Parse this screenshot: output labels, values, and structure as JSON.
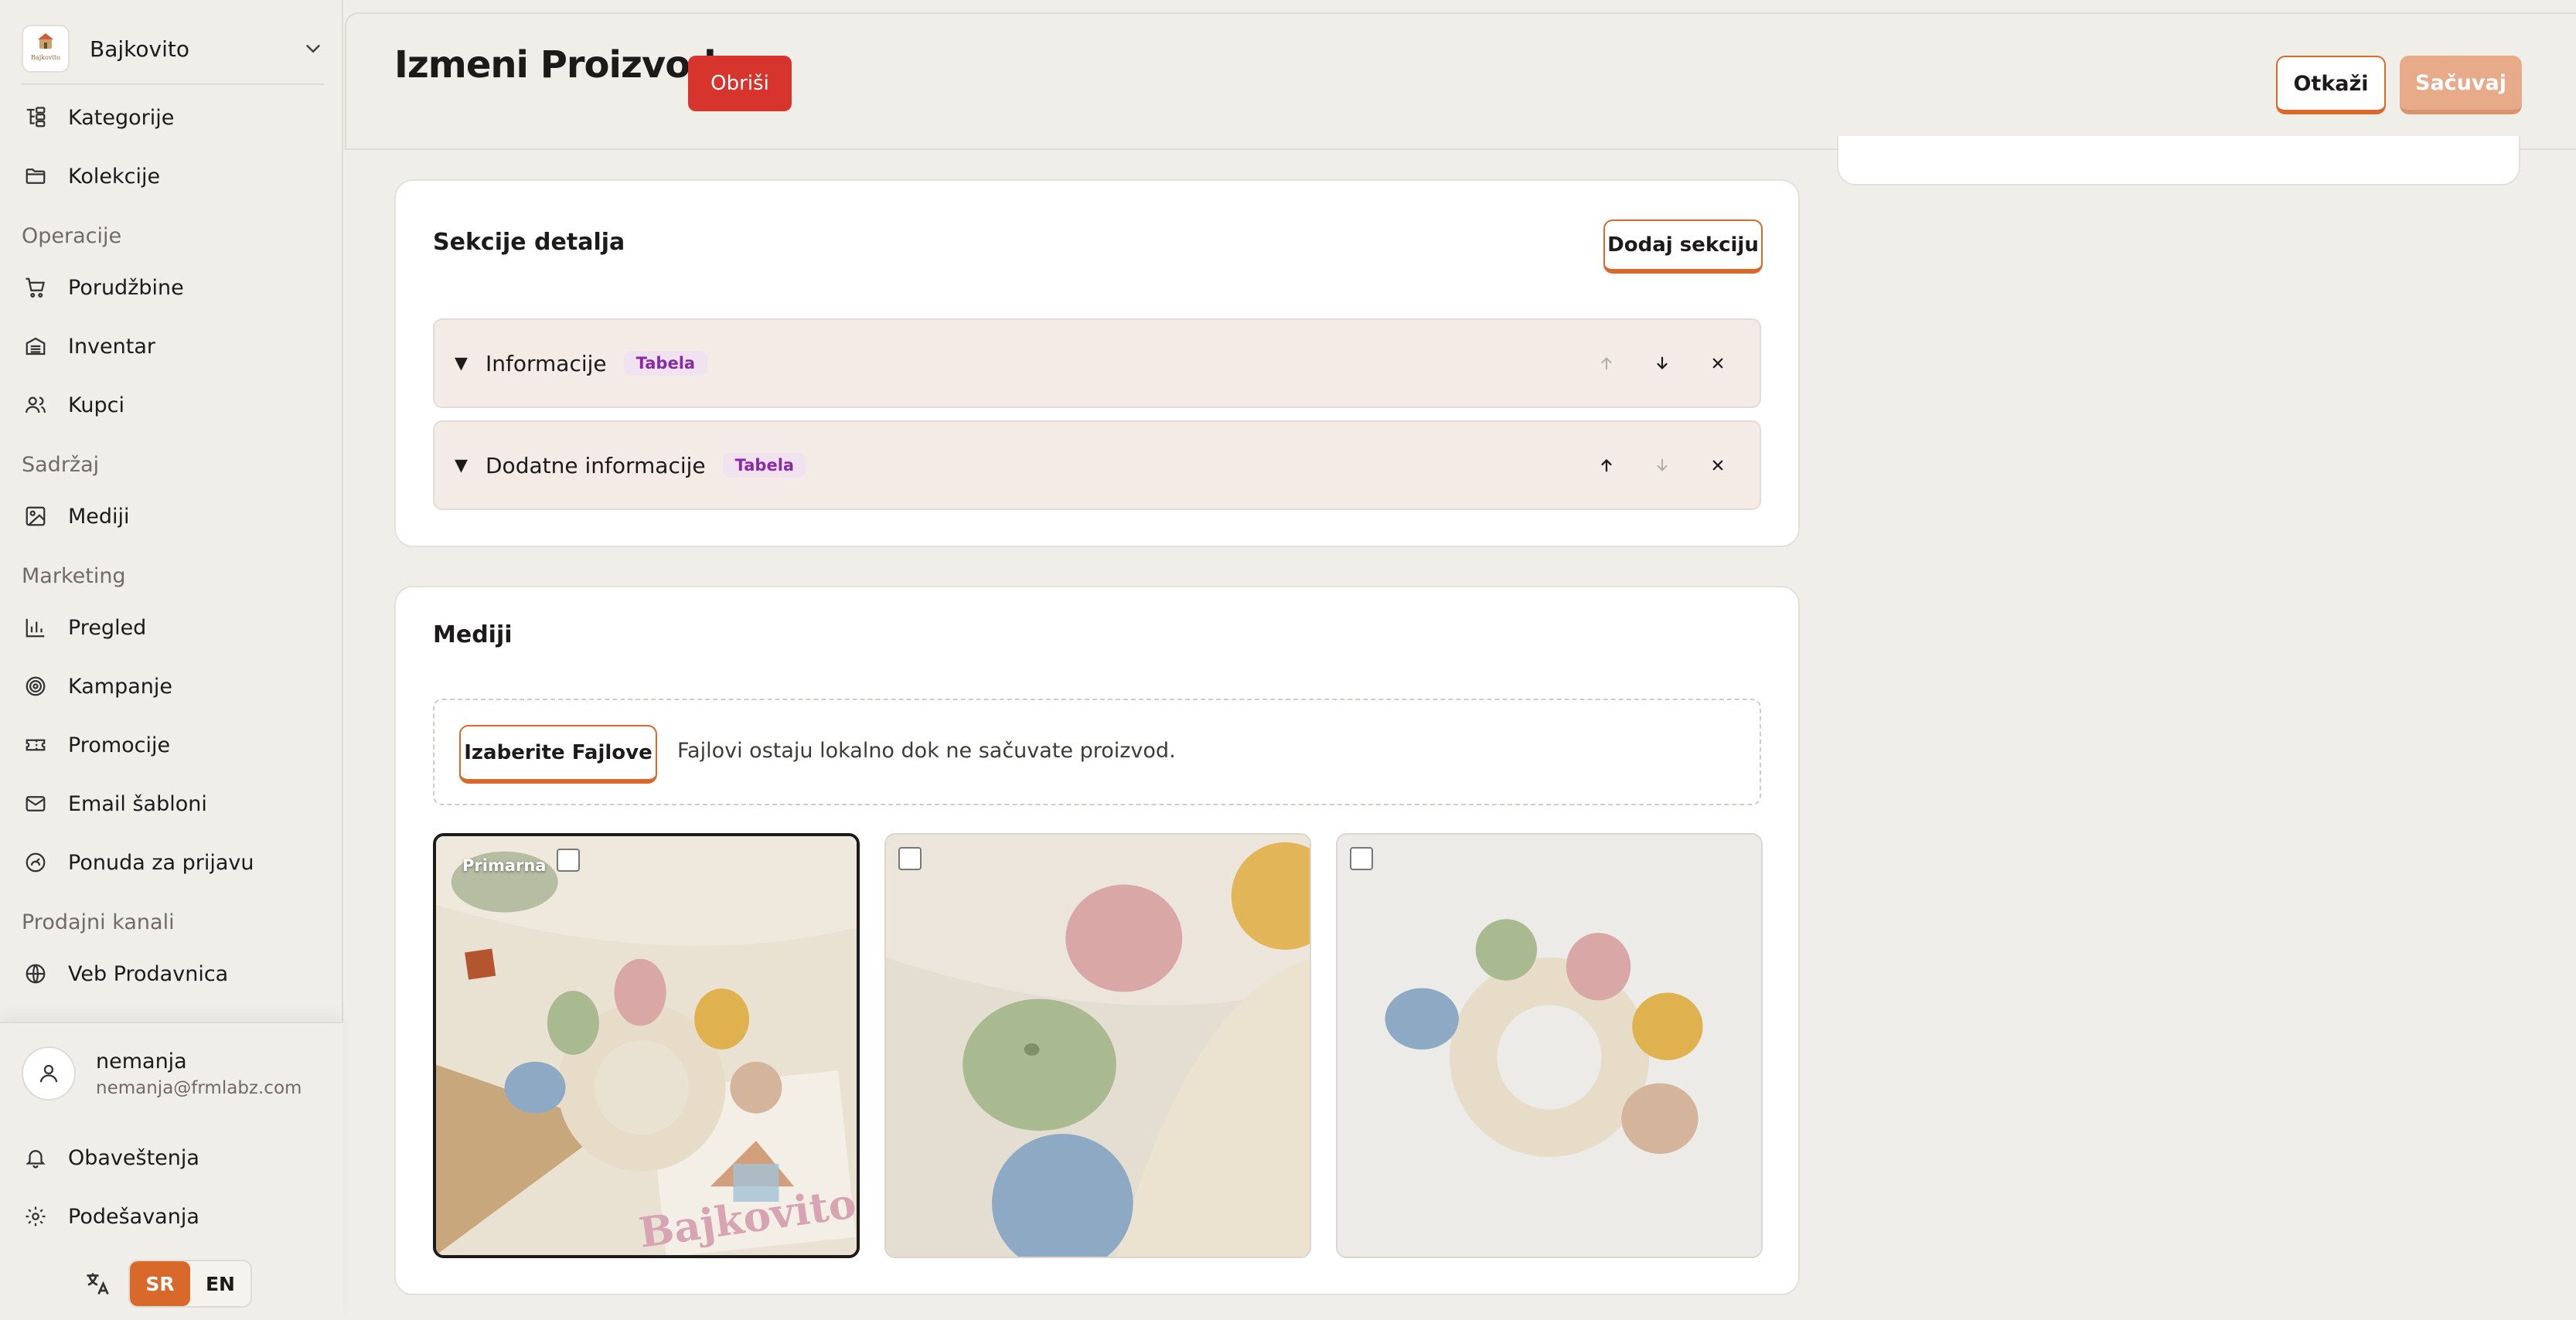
{
  "store": {
    "name": "Bajkovito",
    "logo_text": "Bajkovito"
  },
  "nav": {
    "items_top": [
      {
        "label": "Kategorije"
      },
      {
        "label": "Kolekcije"
      }
    ],
    "sections": {
      "operations": "Operacije",
      "content": "Sadržaj",
      "marketing": "Marketing",
      "channels": "Prodajni kanali"
    },
    "operations_items": [
      {
        "label": "Porudžbine"
      },
      {
        "label": "Inventar"
      },
      {
        "label": "Kupci"
      }
    ],
    "content_items": [
      {
        "label": "Mediji"
      }
    ],
    "marketing_items": [
      {
        "label": "Pregled"
      },
      {
        "label": "Kampanje"
      },
      {
        "label": "Promocije"
      },
      {
        "label": "Email šabloni"
      },
      {
        "label": "Ponuda za prijavu"
      }
    ],
    "channel_items": [
      {
        "label": "Veb Prodavnica"
      }
    ]
  },
  "user": {
    "name": "nemanja",
    "email": "nemanja@frmlabz.com"
  },
  "bottom_nav": {
    "notifications": "Obaveštenja",
    "settings": "Podešavanja"
  },
  "language": {
    "options": [
      "SR",
      "EN"
    ],
    "selected": "SR"
  },
  "header": {
    "title": "Izmeni Proizvod",
    "delete_label": "Obriši",
    "cancel_label": "Otkaži",
    "save_label": "Sačuvaj"
  },
  "detail_sections": {
    "title": "Sekcije detalja",
    "add_label": "Dodaj sekciju",
    "items": [
      {
        "name": "Informacije",
        "tag": "Tabela"
      },
      {
        "name": "Dodatne informacije",
        "tag": "Tabela"
      }
    ]
  },
  "media": {
    "title": "Mediji",
    "choose_label": "Izaberite Fajlove",
    "hint": "Fajlovi ostaju lokalno dok ne sačuvate proizvod.",
    "primary_label": "Primarna",
    "watermark": "Bajkovito"
  },
  "colors": {
    "accent": "#d9682b",
    "danger": "#d6342d",
    "tag_bg": "#f1e2f0",
    "tag_text": "#8a2ba6"
  }
}
